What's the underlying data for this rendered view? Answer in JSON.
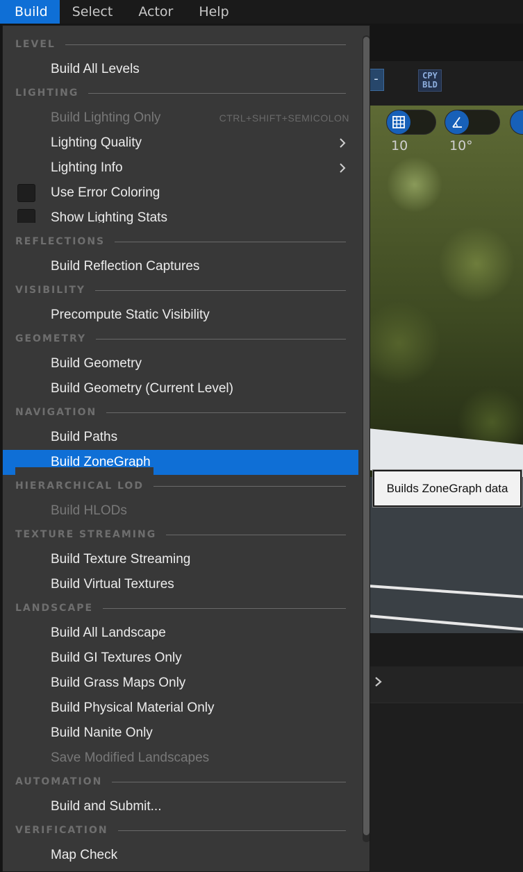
{
  "menubar": {
    "items": [
      {
        "label": "Build",
        "active": true
      },
      {
        "label": "Select",
        "active": false
      },
      {
        "label": "Actor",
        "active": false
      },
      {
        "label": "Help",
        "active": false
      }
    ]
  },
  "background": {
    "toolbar_minus": "-",
    "cpy_label_line1": "CPY",
    "cpy_label_line2": "BLD",
    "grid_snap_value": "10",
    "rotation_snap_value": "10°"
  },
  "tooltip": {
    "text": "Builds ZoneGraph data"
  },
  "menu": {
    "sections": [
      {
        "label": "LEVEL",
        "items": [
          {
            "label": "Build All Levels"
          }
        ]
      },
      {
        "label": "LIGHTING",
        "items": [
          {
            "label": "Build Lighting Only",
            "disabled": true,
            "shortcut": "CTRL+SHIFT+SEMICOLON"
          },
          {
            "label": "Lighting Quality",
            "submenu": true
          },
          {
            "label": "Lighting Info",
            "submenu": true
          },
          {
            "label": "Use Error Coloring",
            "checkbox": true,
            "checked": false
          },
          {
            "label": "Show Lighting Stats",
            "checkbox": true,
            "checked": false
          }
        ]
      },
      {
        "label": "REFLECTIONS",
        "items": [
          {
            "label": "Build Reflection Captures"
          }
        ]
      },
      {
        "label": "VISIBILITY",
        "items": [
          {
            "label": "Precompute Static Visibility"
          }
        ]
      },
      {
        "label": "GEOMETRY",
        "items": [
          {
            "label": "Build Geometry"
          },
          {
            "label": "Build Geometry (Current Level)"
          }
        ]
      },
      {
        "label": "NAVIGATION",
        "items": [
          {
            "label": "Build Paths"
          },
          {
            "label": "Build ZoneGraph",
            "highlighted": true
          }
        ]
      },
      {
        "label": "HIERARCHICAL LOD",
        "items": [
          {
            "label": "Build HLODs",
            "disabled": true
          }
        ]
      },
      {
        "label": "TEXTURE STREAMING",
        "items": [
          {
            "label": "Build Texture Streaming"
          },
          {
            "label": "Build Virtual Textures"
          }
        ]
      },
      {
        "label": "LANDSCAPE",
        "items": [
          {
            "label": "Build All Landscape"
          },
          {
            "label": "Build GI Textures Only"
          },
          {
            "label": "Build Grass Maps Only"
          },
          {
            "label": "Build Physical Material Only"
          },
          {
            "label": "Build Nanite Only"
          },
          {
            "label": "Save Modified Landscapes",
            "disabled": true
          }
        ]
      },
      {
        "label": "AUTOMATION",
        "items": [
          {
            "label": "Build and Submit..."
          }
        ]
      },
      {
        "label": "VERIFICATION",
        "items": [
          {
            "label": "Map Check"
          }
        ]
      }
    ]
  },
  "colors": {
    "accent": "#0f6fd6",
    "menu_bg": "#383838",
    "disabled_text": "#787878"
  }
}
